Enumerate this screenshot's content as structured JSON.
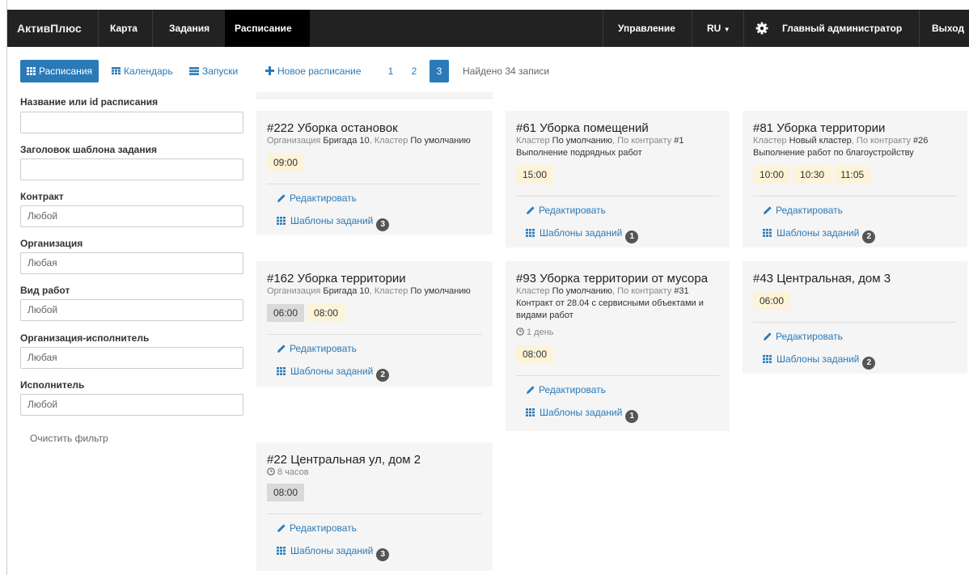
{
  "nav": {
    "brand": "АктивПлюс",
    "items": [
      "Карта",
      "Задания",
      "Расписание"
    ],
    "manage": "Управление",
    "lang": "RU",
    "admin": "Главный администратор",
    "logout": "Выход"
  },
  "toolbar": {
    "schedules": "Расписания",
    "calendar": "Календарь",
    "launches": "Запуски",
    "new": "Новое расписание",
    "pages": [
      "1",
      "2",
      "3"
    ],
    "found": "Найдено 34 записи"
  },
  "filters": {
    "name_label": "Название или id расписания",
    "name_value": "",
    "template_label": "Заголовок шаблона задания",
    "template_value": "",
    "contract_label": "Контракт",
    "contract_value": "Любой",
    "org_label": "Организация",
    "org_value": "Любая",
    "worktype_label": "Вид работ",
    "worktype_value": "Любой",
    "executor_org_label": "Организация-исполнитель",
    "executor_org_value": "Любая",
    "executor_label": "Исполнитель",
    "executor_value": "Любой",
    "clear": "Очистить фильтр"
  },
  "labels": {
    "edit": "Редактировать",
    "templates": "Шаблоны заданий"
  },
  "cards": [
    {
      "title": "#222 Уборка остановок",
      "meta": [
        [
          "Организация ",
          "Бригада 10"
        ],
        [
          ", Кластер ",
          "По умолчанию"
        ]
      ],
      "desc": "",
      "dur": "",
      "times": [
        [
          "09:00",
          false
        ]
      ],
      "count": "3"
    },
    {
      "title": "#61 Уборка помещений",
      "meta": [
        [
          "Кластер ",
          "По умолчанию"
        ],
        [
          ", По контракту ",
          "#1"
        ]
      ],
      "desc": "Выполнение подрядных работ",
      "dur": "",
      "times": [
        [
          "15:00",
          false
        ]
      ],
      "count": "1"
    },
    {
      "title": "#81 Уборка территории",
      "meta": [
        [
          "Кластер ",
          "Новый кластер"
        ],
        [
          ", По контракту ",
          "#26"
        ]
      ],
      "desc": "Выполнение работ по благоустройству",
      "dur": "",
      "times": [
        [
          "10:00",
          false
        ],
        [
          "10:30",
          false
        ],
        [
          "11:05",
          false
        ]
      ],
      "count": "2"
    },
    {
      "title": "#162 Уборка территории",
      "meta": [
        [
          "Организация ",
          "Бригада 10"
        ],
        [
          ", Кластер ",
          "По умолчанию"
        ]
      ],
      "desc": "",
      "dur": "",
      "times": [
        [
          "06:00",
          true
        ],
        [
          "08:00",
          false
        ]
      ],
      "count": "2"
    },
    {
      "title": "#93 Уборка территории от мусора",
      "meta": [
        [
          "Кластер ",
          "По умолчанию"
        ],
        [
          ", По контракту ",
          "#31"
        ]
      ],
      "desc": "Контракт от 28.04 с сервисными объектами и видами работ",
      "dur": "1 день",
      "times": [
        [
          "08:00",
          false
        ]
      ],
      "count": "1"
    },
    {
      "title": "#43 Центральная, дом 3",
      "meta": [],
      "desc": "",
      "dur": "",
      "times": [
        [
          "06:00",
          false
        ]
      ],
      "count": "2"
    },
    {
      "title": "#22 Центральная ул, дом 2",
      "meta": [],
      "desc": "",
      "dur": "8 часов",
      "times": [
        [
          "08:00",
          true
        ]
      ],
      "count": "3"
    }
  ]
}
